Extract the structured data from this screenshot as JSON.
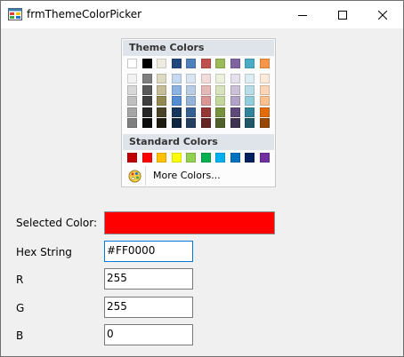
{
  "window": {
    "title": "frmThemeColorPicker"
  },
  "titlebar_buttons": {
    "minimize": "minimize-icon",
    "maximize": "maximize-icon",
    "close": "close-icon"
  },
  "picker": {
    "theme_heading": "Theme Colors",
    "theme_top_row": [
      "#ffffff",
      "#000000",
      "#eeece1",
      "#1f497d",
      "#4f81bd",
      "#c0504d",
      "#9bbb59",
      "#8064a2",
      "#4bacc6",
      "#f79646"
    ],
    "theme_shades": [
      [
        "#f2f2f2",
        "#7f7f7f",
        "#ddd9c3",
        "#c6d9f0",
        "#dbe5f1",
        "#f2dcdb",
        "#ebf1dd",
        "#e5e0ec",
        "#dbeef3",
        "#fdeada"
      ],
      [
        "#d8d8d8",
        "#595959",
        "#c4bd97",
        "#8db3e2",
        "#b8cce4",
        "#e5b9b7",
        "#d7e3bc",
        "#ccc1d9",
        "#b7dde8",
        "#fbd5b5"
      ],
      [
        "#bfbfbf",
        "#3f3f3f",
        "#938953",
        "#548dd4",
        "#95b3d7",
        "#d99694",
        "#c3d69b",
        "#b2a2c7",
        "#92cddc",
        "#fac08f"
      ],
      [
        "#a5a5a5",
        "#262626",
        "#494429",
        "#17365d",
        "#366092",
        "#953734",
        "#76923c",
        "#5f497a",
        "#31859b",
        "#e36c09"
      ],
      [
        "#7f7f7f",
        "#0c0c0c",
        "#1d1b10",
        "#0f243e",
        "#244061",
        "#632423",
        "#4f6128",
        "#3f3151",
        "#205867",
        "#974806"
      ]
    ],
    "standard_heading": "Standard Colors",
    "standard_colors": [
      "#c00000",
      "#ff0000",
      "#ffc000",
      "#ffff00",
      "#92d050",
      "#00b050",
      "#00b0f0",
      "#0070c0",
      "#002060",
      "#7030a0"
    ],
    "more_icon": "palette-icon",
    "more_label": "More Colors..."
  },
  "form": {
    "selected_label": "Selected Color:",
    "selected_color": "#ff0000",
    "hex_label": "Hex String",
    "hex_value": "#FF0000",
    "r_label": "R",
    "r_value": "255",
    "g_label": "G",
    "g_value": "255",
    "b_label": "B",
    "b_value": "0"
  }
}
